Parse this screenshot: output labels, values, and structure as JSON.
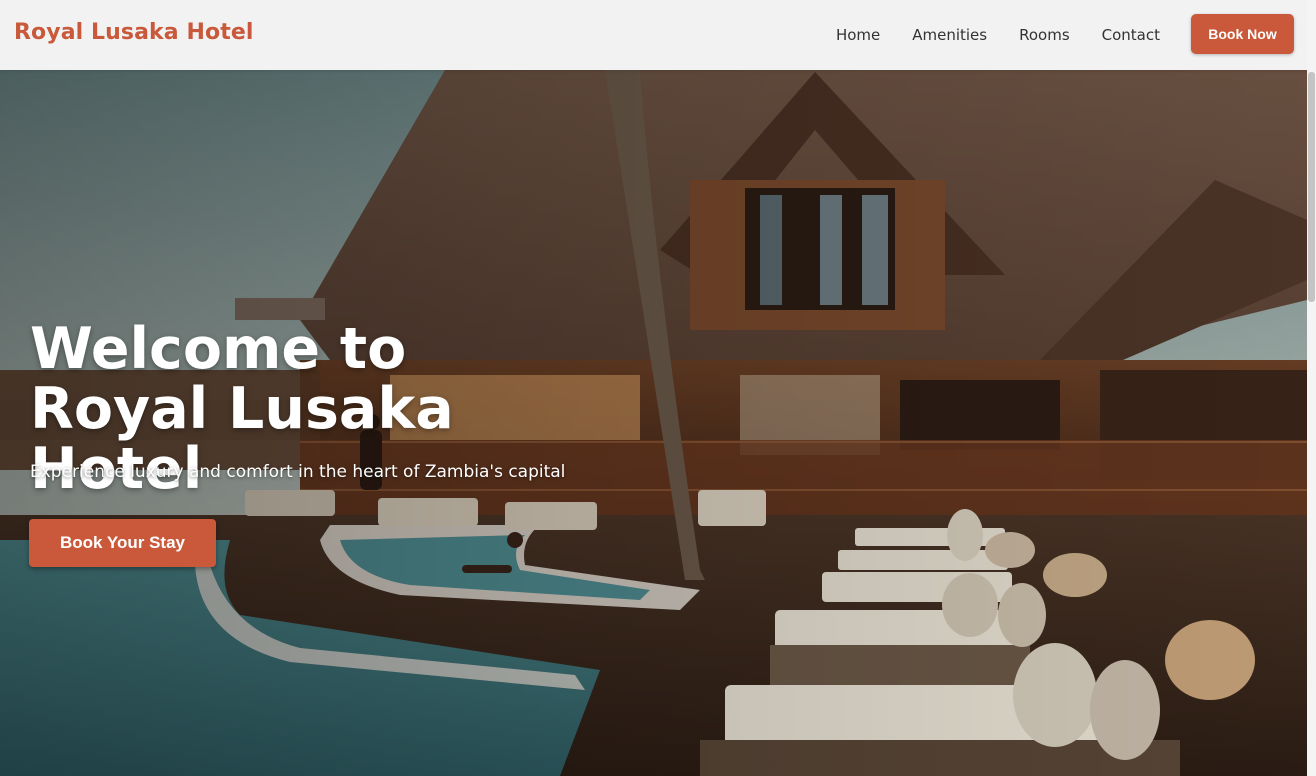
{
  "brand": {
    "name": "Royal Lusaka Hotel"
  },
  "nav": {
    "links": [
      "Home",
      "Amenities",
      "Rooms",
      "Contact"
    ],
    "book_now": "Book Now"
  },
  "hero": {
    "title": "Welcome to Royal Lusaka Hotel",
    "subtitle": "Experience luxury and comfort in the heart of Zambia's capital",
    "cta": "Book Your Stay"
  },
  "colors": {
    "accent": "#c9593a",
    "navbar_bg": "#f2f2f3"
  }
}
